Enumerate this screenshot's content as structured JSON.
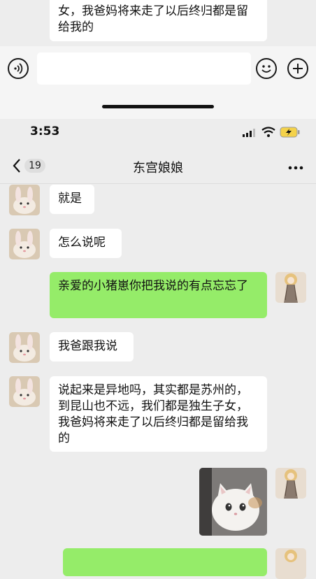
{
  "top_fragment": {
    "message_text": "的，到昆山也不远，我们都是独生子女，我爸妈将来走了以后终归都是留给我的"
  },
  "input_bar": {
    "placeholder": ""
  },
  "status_bar": {
    "time": "3:53"
  },
  "nav": {
    "unread_count": "19",
    "title": "东宫娘娘"
  },
  "messages": [
    {
      "sender": "other",
      "text": "就是"
    },
    {
      "sender": "other",
      "text": "怎么说呢"
    },
    {
      "sender": "self",
      "text": "亲爱的小猪崽你把我说的有点忘忘了"
    },
    {
      "sender": "other",
      "text": "我爸跟我说"
    },
    {
      "sender": "other",
      "text": "说起来是异地吗，其实都是苏州的，到昆山也不远，我们都是独生子女，我爸妈将来走了以后终归都是留给我的"
    },
    {
      "sender": "self",
      "type": "image",
      "description_icon": "cat-photo"
    }
  ],
  "colors": {
    "background": "#ededed",
    "self_bubble": "#95ec69",
    "other_bubble": "#ffffff"
  }
}
